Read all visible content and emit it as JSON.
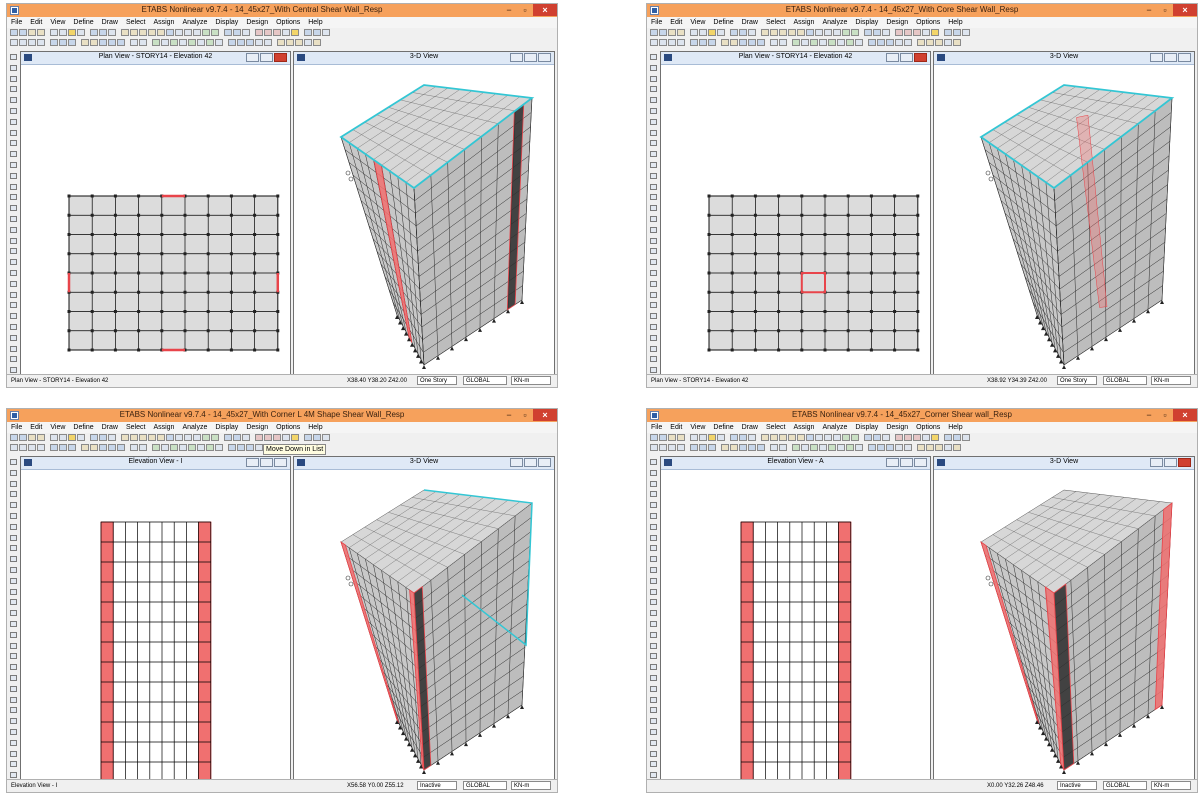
{
  "menu": [
    "File",
    "Edit",
    "View",
    "Define",
    "Draw",
    "Select",
    "Assign",
    "Analyze",
    "Display",
    "Design",
    "Options",
    "Help"
  ],
  "window_controls": {
    "minimize": "−",
    "maximize": "▫",
    "close": "×"
  },
  "windows": [
    {
      "title": "ETABS Nonlinear v9.7.4 - 14_45x27_With Central Shear Wall_Resp",
      "left_pane_title": "Plan View - STORY14 - Elevation 42",
      "right_pane_title": "3-D View",
      "status_left": "Plan View - STORY14 - Elevation 42",
      "status_coords": "X38.40  Y38.20  Z42.00",
      "story_selector": "One Story",
      "coordinate_system": "GLOBAL",
      "units": "KN-m",
      "tooltip": ""
    },
    {
      "title": "ETABS Nonlinear v9.7.4 - 14_45x27_With Core Shear Wall_Resp",
      "left_pane_title": "Plan View - STORY14 - Elevation 42",
      "right_pane_title": "3-D View",
      "status_left": "Plan View - STORY14 - Elevation 42",
      "status_coords": "X38.92  Y34.39  Z42.00",
      "story_selector": "One Story",
      "coordinate_system": "GLOBAL",
      "units": "KN-m",
      "tooltip": ""
    },
    {
      "title": "ETABS Nonlinear v9.7.4 - 14_45x27_With Corner L 4M Shape Shear Wall_Resp",
      "left_pane_title": "Elevation View - I",
      "right_pane_title": "3-D View",
      "status_left": "Elevation View - I",
      "status_coords": "X56.58  Y0.00  Z55.12",
      "story_selector": "Inactive",
      "coordinate_system": "GLOBAL",
      "units": "KN-m",
      "tooltip": "Move Down in List"
    },
    {
      "title": "ETABS Nonlinear v9.7.4 - 14_45x27_Corner Shear wall_Resp",
      "left_pane_title": "Elevation View - A",
      "right_pane_title": "3-D View",
      "status_left": "",
      "status_coords": "X0.00  Y32.26  Z48.46",
      "story_selector": "Inactive",
      "coordinate_system": "GLOBAL",
      "units": "KN-m",
      "tooltip": ""
    }
  ],
  "colors": {
    "titlebar": "#f6a15c",
    "close_button": "#d04030",
    "shear_wall": "#e8444a",
    "shear_wall_fill": "#f07070",
    "slab_edge": "#33c6d4",
    "grid_line": "#000000",
    "slab_fill": "#dcdcdc",
    "pane_header": "#dfe9f6"
  },
  "icons": {
    "app": "etabs-app-icon",
    "pane": "pane-icon"
  }
}
